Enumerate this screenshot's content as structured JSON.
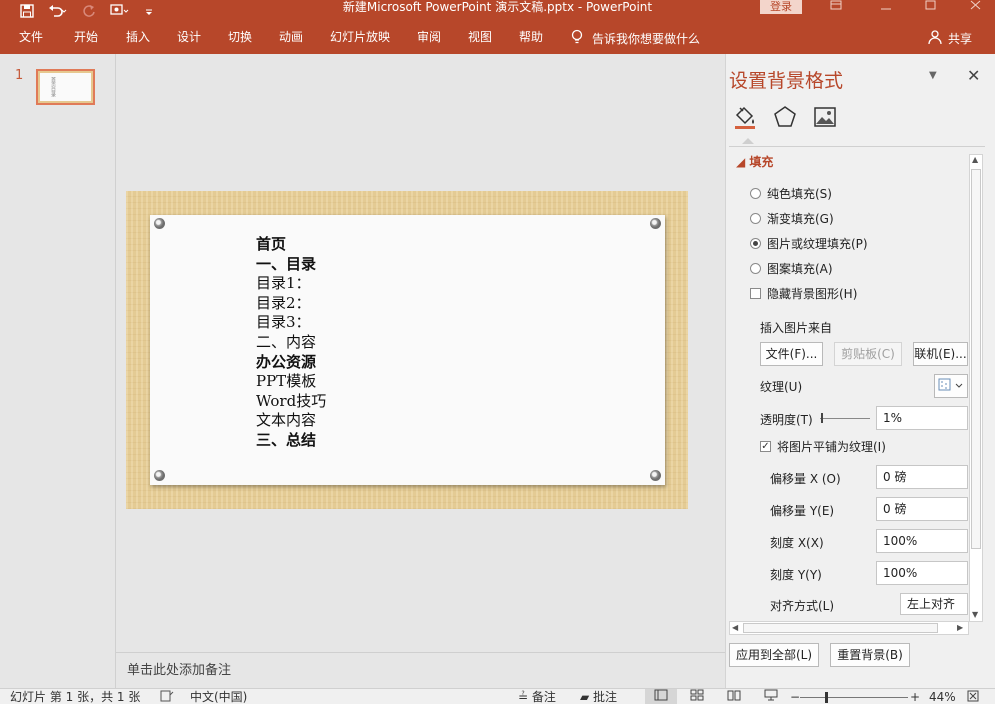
{
  "titlebar": {
    "title": "新建Microsoft PowerPoint 演示文稿.pptx  -  PowerPoint",
    "login": "登录"
  },
  "ribbon": {
    "tabs": [
      "文件",
      "开始",
      "插入",
      "设计",
      "切换",
      "动画",
      "幻灯片放映",
      "审阅",
      "视图",
      "帮助"
    ],
    "tell_me": "告诉我你想要做什么",
    "share": "共享"
  },
  "thumbnails": {
    "slide_number": "1",
    "thumb_text": "首页目录"
  },
  "slide": {
    "lines": [
      {
        "text": "首页",
        "bold": true
      },
      {
        "text": "一、目录",
        "bold": true
      },
      {
        "text": "目录1：",
        "bold": false
      },
      {
        "text": "目录2：",
        "bold": false
      },
      {
        "text": "目录3：",
        "bold": false
      },
      {
        "text": "二、内容",
        "bold": false
      },
      {
        "text": "办公资源",
        "bold": true
      },
      {
        "text": "PPT模板",
        "bold": false
      },
      {
        "text": "Word技巧",
        "bold": false
      },
      {
        "text": "文本内容",
        "bold": false
      },
      {
        "text": "三、总结",
        "bold": true
      }
    ]
  },
  "notes": {
    "placeholder": "单击此处添加备注"
  },
  "format_pane": {
    "title": "设置背景格式",
    "section": "填充",
    "fill_options": [
      {
        "label": "纯色填充(S)",
        "selected": false
      },
      {
        "label": "渐变填充(G)",
        "selected": false
      },
      {
        "label": "图片或纹理填充(P)",
        "selected": true
      },
      {
        "label": "图案填充(A)",
        "selected": false
      }
    ],
    "hide_bg_graphics": {
      "label": "隐藏背景图形(H)",
      "checked": false
    },
    "insert_from_label": "插入图片来自",
    "buttons": {
      "file": "文件(F)...",
      "clipboard": "剪贴板(C)",
      "online": "联机(E)..."
    },
    "texture_label": "纹理(U)",
    "transparency": {
      "label": "透明度(T)",
      "value": "1%"
    },
    "tile": {
      "label": "将图片平铺为纹理(I)",
      "checked": true
    },
    "offset_x": {
      "label": "偏移量 X (O)",
      "value": "0 磅"
    },
    "offset_y": {
      "label": "偏移量 Y(E)",
      "value": "0 磅"
    },
    "scale_x": {
      "label": "刻度 X(X)",
      "value": "100%"
    },
    "scale_y": {
      "label": "刻度 Y(Y)",
      "value": "100%"
    },
    "alignment": {
      "label": "对齐方式(L)",
      "value": "左上对齐"
    },
    "apply_all": "应用到全部(L)",
    "reset_bg": "重置背景(B)"
  },
  "statusbar": {
    "slide_info": "幻灯片 第 1 张，共 1 张",
    "language": "中文(中国)",
    "notes": "备注",
    "comments": "批注",
    "zoom": "44%",
    "zoom_fraction": 0.24
  }
}
